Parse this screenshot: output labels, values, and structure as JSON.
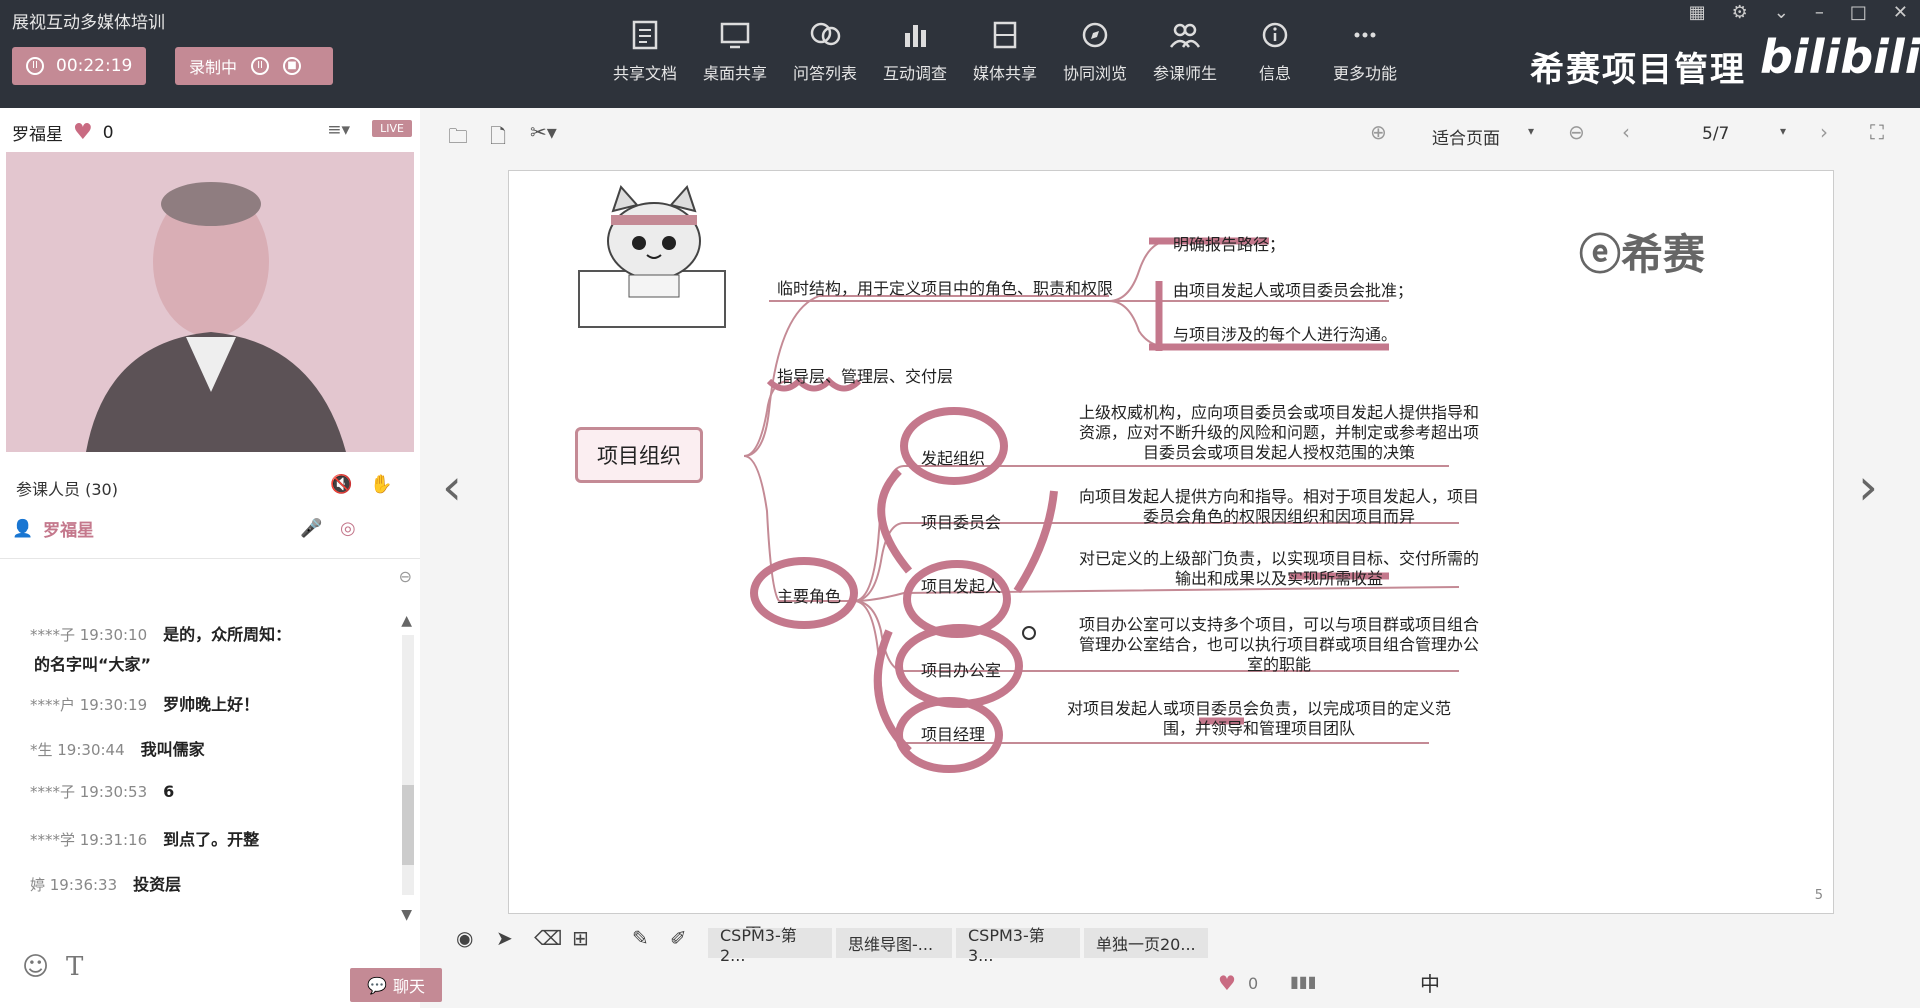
{
  "app": {
    "title": "展视互动多媒体培训"
  },
  "recording": {
    "time": "00:22:19",
    "status": "录制中"
  },
  "toolbar": {
    "items": [
      {
        "label": "共享文档",
        "icon": "document-icon"
      },
      {
        "label": "桌面共享",
        "icon": "monitor-icon"
      },
      {
        "label": "问答列表",
        "icon": "chat-bubbles-icon"
      },
      {
        "label": "互动调查",
        "icon": "bar-chart-icon"
      },
      {
        "label": "媒体共享",
        "icon": "film-icon"
      },
      {
        "label": "协同浏览",
        "icon": "compass-icon"
      },
      {
        "label": "参课师生",
        "icon": "users-icon"
      },
      {
        "label": "信息",
        "icon": "info-icon"
      },
      {
        "label": "更多功能",
        "icon": "more-icon"
      }
    ]
  },
  "brand": {
    "text": "希赛项目管理",
    "logo": "bilibili"
  },
  "host": {
    "name": "罗福星",
    "likes": "0",
    "badge": "LIVE"
  },
  "participants": {
    "title": "参课人员 (30)",
    "member": "罗福星"
  },
  "chat": {
    "messages": [
      {
        "meta": "****子 19:30:10",
        "text": "是的，众所周知："
      },
      {
        "meta": "",
        "text": "的名字叫“大家”"
      },
      {
        "meta": "****户 19:30:19",
        "text": "罗帅晚上好！"
      },
      {
        "meta": "*生 19:30:44",
        "text": "我叫儒家"
      },
      {
        "meta": "****子 19:30:53",
        "text": "6"
      },
      {
        "meta": "****学 19:31:16",
        "text": "到点了。开整"
      },
      {
        "meta": "婷 19:36:33",
        "text": "投资层"
      }
    ],
    "tab_label": "聊天"
  },
  "viewer": {
    "zoom": "适合页面",
    "page": "5/7",
    "slide_number": "5"
  },
  "mindmap": {
    "root": "项目组织",
    "branch1": "临时结构，用于定义项目中的角色、职责和权限",
    "branch1_items": [
      "明确报告路径；",
      "由项目发起人或项目委员会批准；",
      "与项目涉及的每个人进行沟通。"
    ],
    "branch2": "指导层、管理层、交付层",
    "branch3": "主要角色",
    "roles": [
      {
        "name": "发起组织",
        "desc": [
          "上级权威机构，应向项目委员会或项目发起人提供指导和",
          "资源，应对不断升级的风险和问题，并制定或参考超出项",
          "目委员会或项目发起人授权范围的决策"
        ]
      },
      {
        "name": "项目委员会",
        "desc": [
          "向项目发起人提供方向和指导。相对于项目发起人，项目",
          "委员会角色的权限因组织和因项目而异"
        ]
      },
      {
        "name": "项目发起人",
        "desc": [
          "对已定义的上级部门负责，以实现项目目标、交付所需的",
          "输出和成果以及实现所需收益"
        ]
      },
      {
        "name": "项目办公室",
        "desc": [
          "项目办公室可以支持多个项目，可以与项目群或项目组合",
          "管理办公室结合，也可以执行项目群或项目组合管理办公",
          "室的职能"
        ]
      },
      {
        "name": "项目经理",
        "desc": [
          "对项目发起人或项目委员会负责，以完成项目的定义范",
          "围，并领导和管理项目团队"
        ]
      }
    ],
    "logo": "希赛"
  },
  "tabs": [
    "CSPM3-第2...",
    "思维导图-...",
    "CSPM3-第3...",
    "单独一页20..."
  ],
  "status": {
    "likes": "0",
    "ime": "中"
  },
  "colors": {
    "accent": "#c48a95",
    "ink": "#c4788c"
  }
}
